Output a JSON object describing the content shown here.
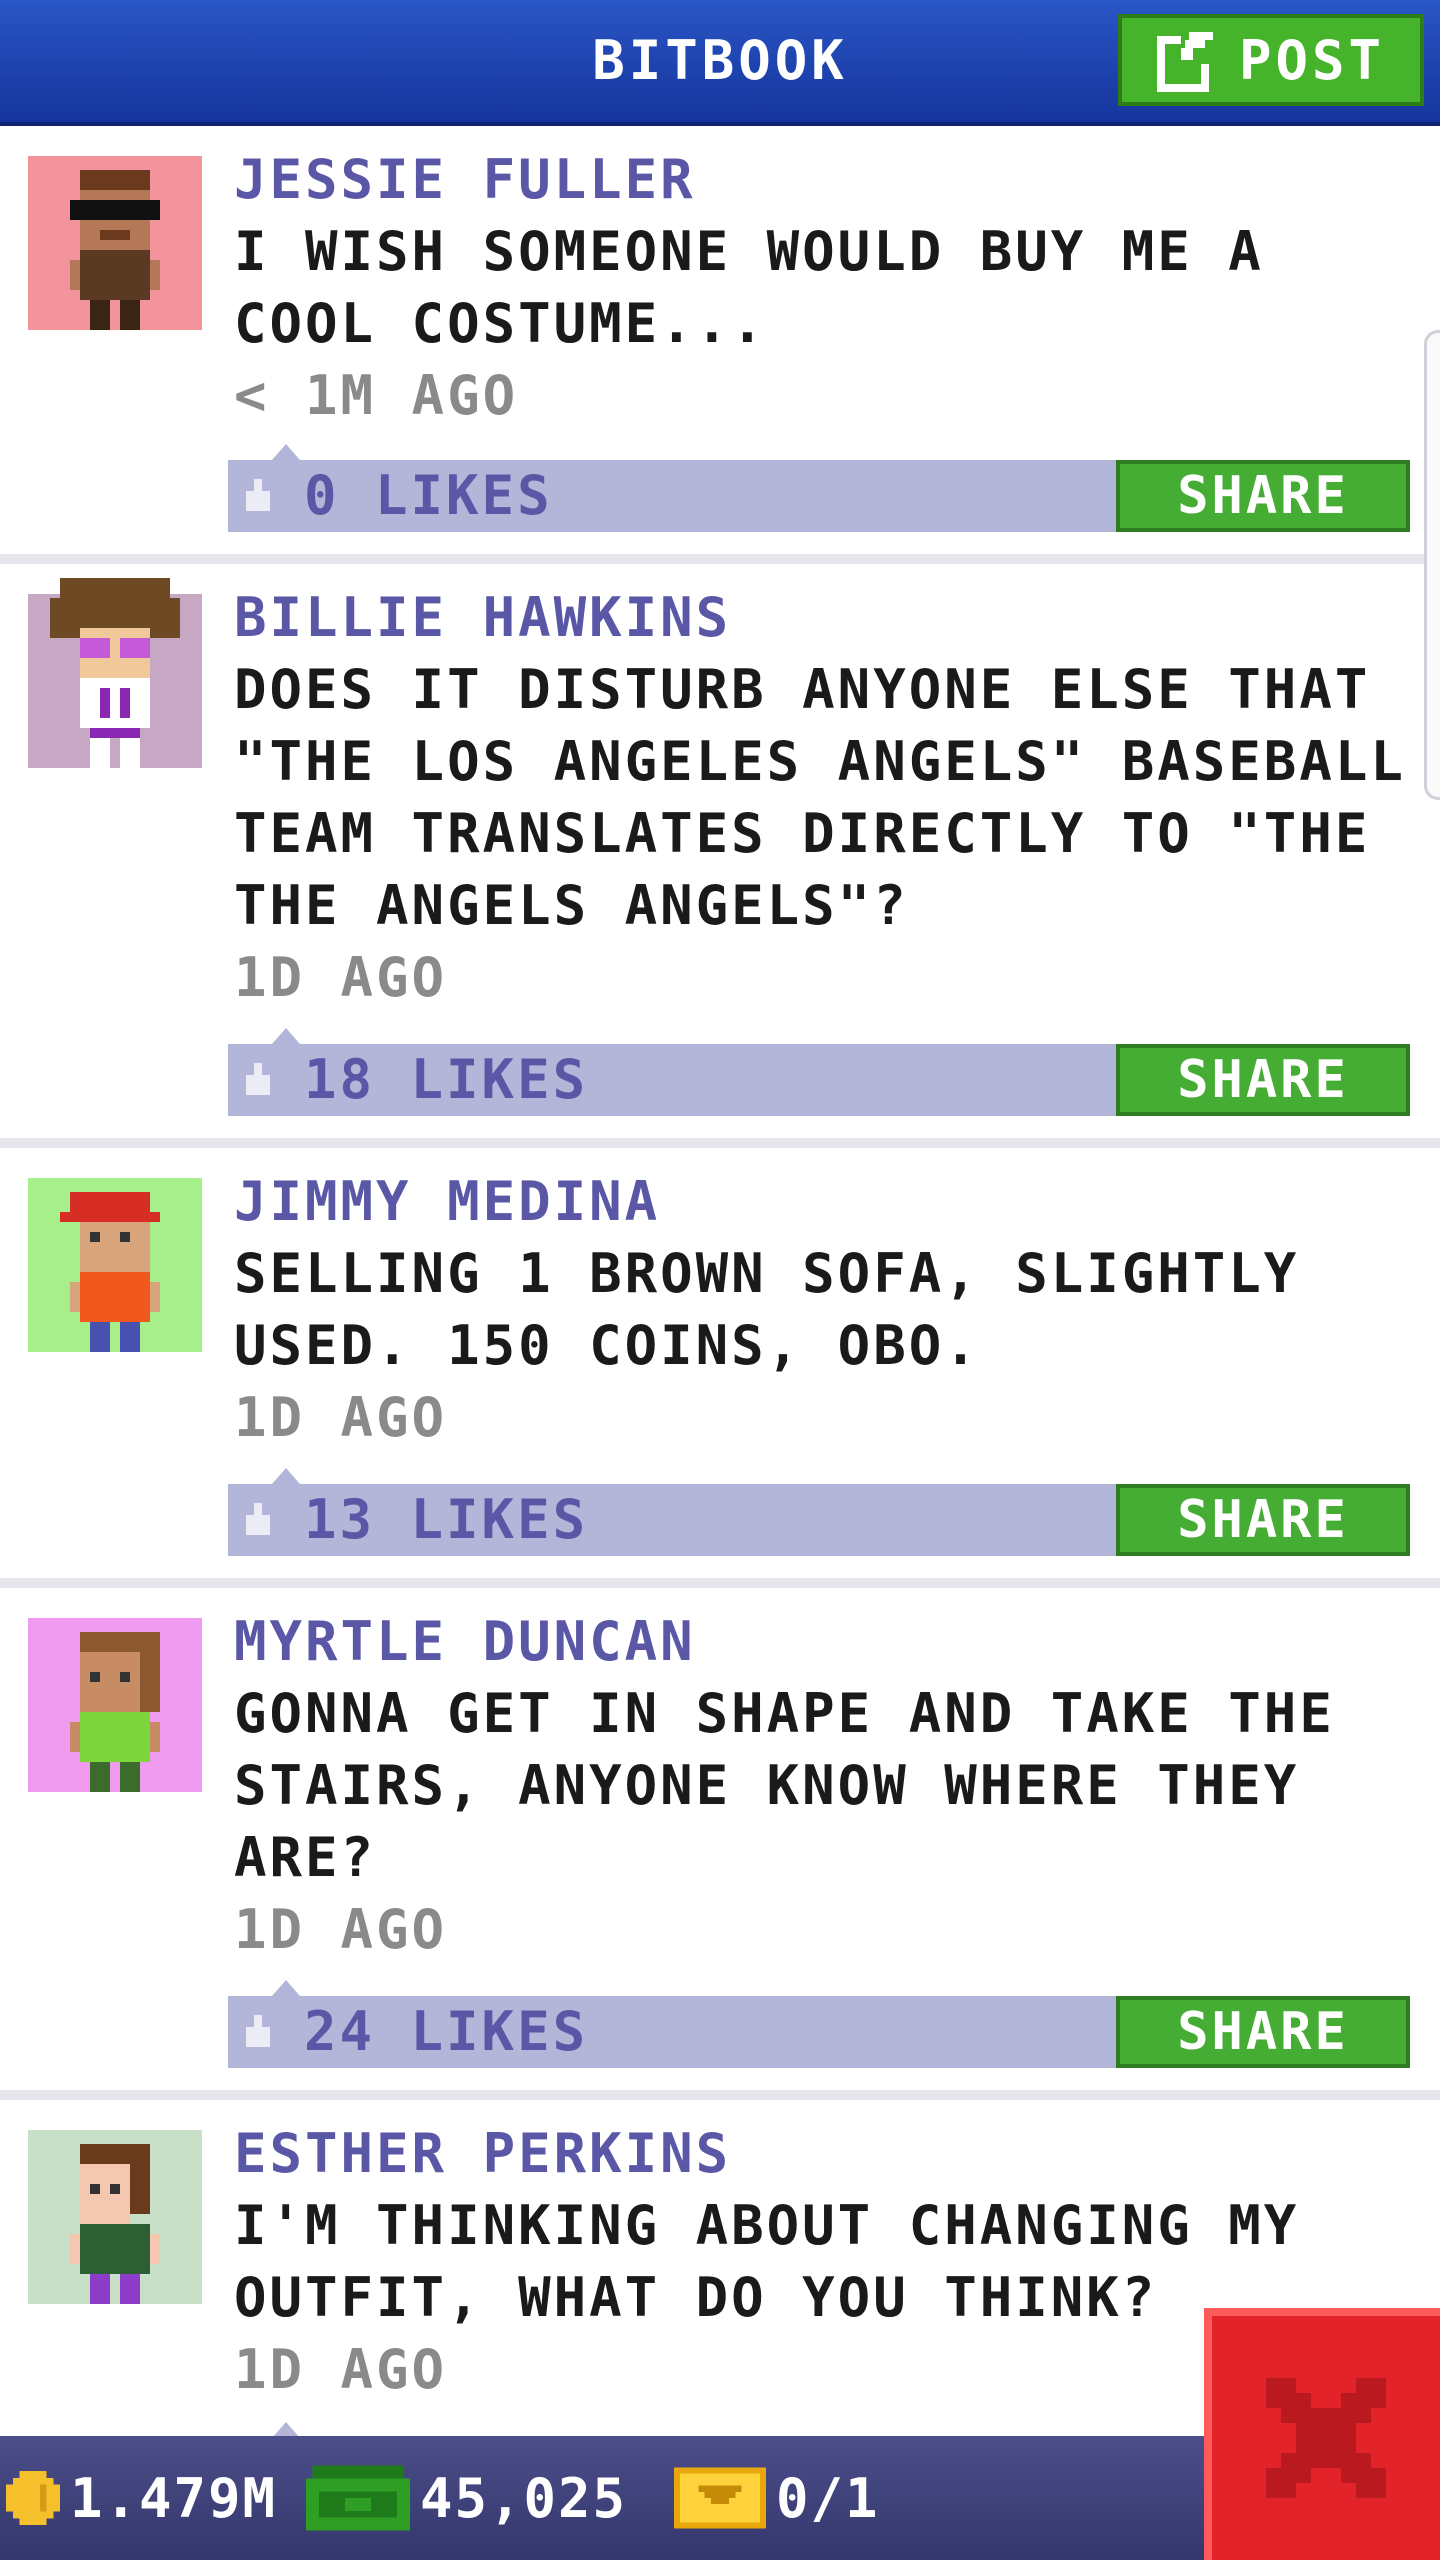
{
  "header": {
    "title": "BITBOOK",
    "post_label": "POST"
  },
  "posts": [
    {
      "author": "JESSIE FULLER",
      "text": "I WISH SOMEONE WOULD BUY ME A COOL COSTUME...",
      "time": "< 1M AGO",
      "likes": "0 LIKES",
      "share": "SHARE",
      "avatar_bg": "#f3949c"
    },
    {
      "author": "BILLIE HAWKINS",
      "text": "DOES IT DISTURB ANYONE ELSE THAT \"THE LOS ANGELES ANGELS\" BASEBALL TEAM TRANSLATES DIRECTLY TO \"THE THE ANGELS ANGELS\"?",
      "time": "1D AGO",
      "likes": "18 LIKES",
      "share": "SHARE",
      "avatar_bg": "#c6a8c4"
    },
    {
      "author": "JIMMY MEDINA",
      "text": "SELLING 1 BROWN SOFA, SLIGHTLY USED. 150 COINS, OBO.",
      "time": "1D AGO",
      "likes": "13 LIKES",
      "share": "SHARE",
      "avatar_bg": "#a6ef8a"
    },
    {
      "author": "MYRTLE DUNCAN",
      "text": "GONNA GET IN SHAPE AND TAKE THE STAIRS, ANYONE KNOW WHERE THEY ARE?",
      "time": "1D AGO",
      "likes": "24 LIKES",
      "share": "SHARE",
      "avatar_bg": "#f09af0"
    },
    {
      "author": "ESTHER PERKINS",
      "text": "I'M THINKING ABOUT CHANGING MY OUTFIT, WHAT DO YOU THINK?",
      "time": "1D AGO",
      "likes": "",
      "share": "",
      "avatar_bg": "#c8e0c8"
    }
  ],
  "footer": {
    "coins": "1.479M",
    "bux": "45,025",
    "tickets": "0/1"
  },
  "colors": {
    "header": "#1f44b4",
    "share_green": "#46ad34",
    "like_bar": "#b3b6d8",
    "close_red": "#e3232a"
  }
}
